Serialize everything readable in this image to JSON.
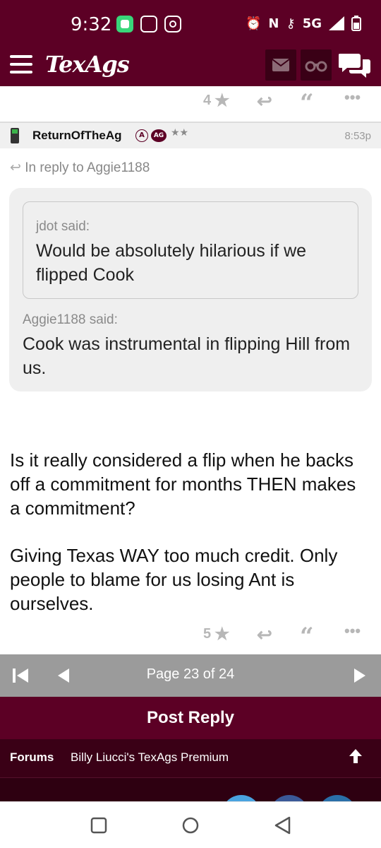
{
  "status_bar": {
    "time": "9:32",
    "network": "5G"
  },
  "app": {
    "logo_text": "TexAgs",
    "brand_color": "#5c0025",
    "icons": [
      "menu-icon",
      "mail-icon",
      "binoculars-icon",
      "chat-icon"
    ]
  },
  "previous_post_actions": {
    "star_count": "4"
  },
  "post": {
    "author": "ReturnOfTheAg",
    "badge_a": "A",
    "badge_ag": "AG",
    "rank_stars": "★★",
    "time": "8:53p",
    "reply_to": "In reply to Aggie1188",
    "nested_quote": {
      "said": "jdot said:",
      "text": "Would be absolutely hilarious if we flipped Cook"
    },
    "quote": {
      "said": "Aggie1188 said:",
      "text": "Cook was instrumental in flipping Hill from us."
    },
    "paragraphs": [
      "Is it really considered a flip when he backs off a commitment for months THEN makes a commitment?",
      "Giving Texas WAY too much credit. Only people to blame for us losing Ant is ourselves."
    ],
    "star_count": "5"
  },
  "pager": {
    "label": "Page 23 of 24"
  },
  "post_reply_label": "Post Reply",
  "footer": {
    "forums_label": "Forums",
    "forum_name": "Billy Liucci's TexAgs Premium"
  }
}
